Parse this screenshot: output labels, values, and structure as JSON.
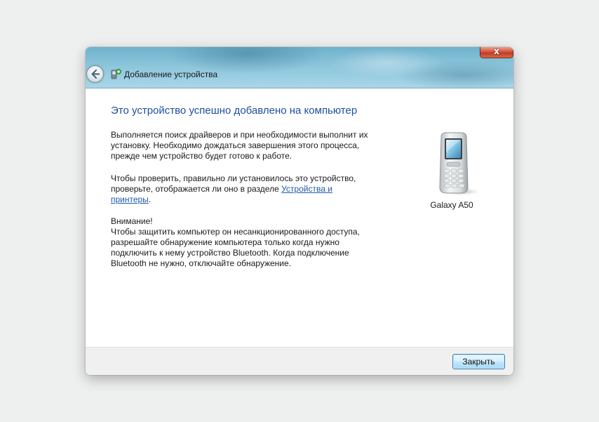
{
  "window": {
    "title": "Добавление устройства",
    "close_glyph": "x"
  },
  "main": {
    "headline": "Это устройство успешно добавлено на компьютер",
    "paragraph1": [
      "Выполняется поиск драйверов и при необходимости выполнит их",
      "установку. Необходимо дождаться завершения этого процесса,",
      "прежде чем устройство будет готово к работе."
    ],
    "paragraph2": {
      "line1": "Чтобы проверить, правильно ли установилось это устройство,",
      "line2_prefix": "проверьте, отображается ли оно в разделе ",
      "link_part1": "Устройства и",
      "link_part2": "принтеры",
      "line3_suffix": "."
    },
    "paragraph3": [
      "Внимание!",
      "Чтобы защитить компьютер он несанкционированного доступа,",
      "разрешайте обнаружение компьютера только когда нужно",
      "подключить к нему устройство Bluetooth. Когда подключение",
      "Bluetooth не нужно, отключайте обнаружение."
    ]
  },
  "device": {
    "name": "Galaxy A50",
    "icon": "mobile-phone-icon"
  },
  "footer": {
    "close_label": "Закрыть"
  },
  "colors": {
    "headline": "#1e4ea3",
    "link": "#1f5aa8",
    "close_button_red": "#c23a21",
    "titlebar_glass": "#8cc5db"
  }
}
